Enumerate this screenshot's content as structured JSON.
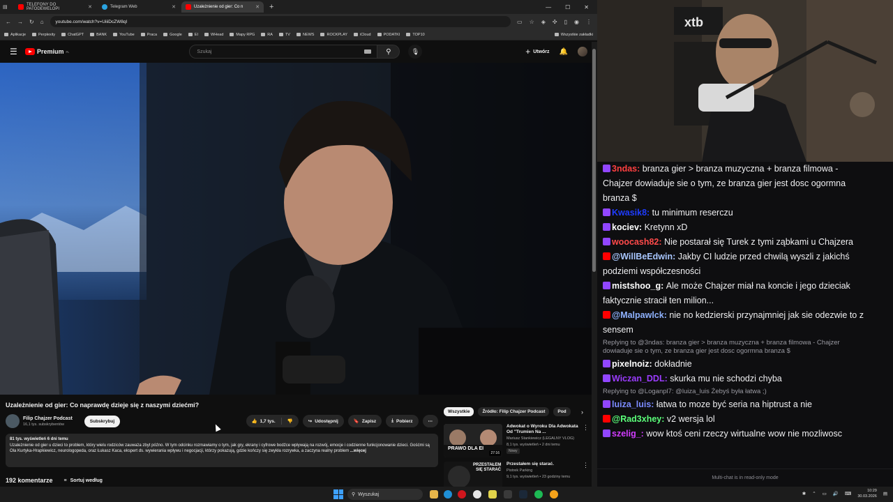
{
  "browser": {
    "tabs": [
      {
        "label": "TELEFONY DO PATODEWELOPI"
      },
      {
        "label": "Telegram Web"
      },
      {
        "label": "Uzależnienie od gier: Co n"
      }
    ],
    "url": "youtube.com/watch?v=UiiiDcZW8qI",
    "bookmarks": [
      "Aplikacje",
      "Perplexity",
      "ChatGPT",
      "BANK",
      "YouTube",
      "Praca",
      "Google",
      "EI",
      "WHead",
      "Mapy RPG",
      "RA",
      "TV",
      "NEWS",
      "ROCKPLAY",
      "iCloud",
      "PODATKI",
      "TOP10"
    ],
    "bookmarks_all": "Wszystkie zakładki"
  },
  "youtube": {
    "logo": "Premium",
    "logo_region": "PL",
    "search_placeholder": "Szukaj",
    "create_label": "Utwórz",
    "video_title": "Uzależnienie od gier: Co naprawdę dzieje się z naszymi dziećmi?",
    "channel_name": "Filip Chajzer Podcast",
    "channel_subs": "16,1 tys. subskrybentów",
    "subscribe": "Subskrybuj",
    "likes": "1,7 tys.",
    "share": "Udostępnij",
    "save": "Zapisz",
    "download": "Pobierz",
    "description_meta": "81 tys. wyświetleń  6 dni temu",
    "description_text": "Uzależnienie od gier u dzieci to problem, który wielu rodziców zauważa zbyt późno. W tym odcinku rozmawiamy o tym, jak gry, ekrany i cyfrowe bodźce wpływają na rozwój, emocje i codzienne funkcjonowanie dzieci. Gośćmi są Ola Kurtyka-Hrapkiewicz, neurologopeda, oraz Łukasz Kaca, ekspert ds. wywierania wpływu i negocjacji, którzy pokazują, gdzie kończy się zwykła rozrywka, a zaczyna realny problem",
    "description_more": "...więcej",
    "comments_count": "192 komentarze",
    "sort_label": "Sortuj według",
    "chips": [
      "Wszystkie",
      "Źródło: Filip Chajzer Podcast",
      "Pod"
    ],
    "recommendations": [
      {
        "title": "Adwokat o Wyroku Dla Adwokata Od \"Trumien Na ...",
        "channel": "Mariusz Stankiewicz (LEGALNY VLOG)",
        "meta": "8,1 tys. wyświetleń • 2 dni temu",
        "badge": "Nowy",
        "duration": "27:16",
        "thumb_text": "PRAWO DLA EI"
      },
      {
        "title": "Przestałem się starać.",
        "channel": "Piotrek Parking",
        "meta": "9,1 tys. wyświetleń • 23 godziny temu",
        "thumb_text": "PRZESTAŁEM SIĘ STARAĆ"
      }
    ]
  },
  "chat": {
    "messages": [
      {
        "user": "3ndas:",
        "color": "#ff4040",
        "text": "branza gier > branza muzyczna + branza filmowa - Chajzer dowiaduje sie o tym, ze branza gier jest dosc ogormna branza $",
        "platform": "twitch"
      },
      {
        "user": "Kwasik8:",
        "color": "#1e3cff",
        "text": "tu minimum reserczu",
        "platform": "twitch"
      },
      {
        "user": "kociev:",
        "color": "#ffffff",
        "text": "Kretynn xD",
        "platform": "twitch"
      },
      {
        "user": "woocash82:",
        "color": "#ff4a4a",
        "text": "Nie postarał się Turek z tymi ząbkami u Chajzera",
        "platform": "twitch"
      },
      {
        "user": "@WillBeEdwin:",
        "color": "#a9c7ff",
        "text": "Jakby CI ludzie przed chwilą wyszli z jakichś podziemi współczesności",
        "platform": "youtube"
      },
      {
        "user": "mistshoo_g:",
        "color": "#ffffff",
        "text": "Ale może Chajzer miał na koncie i jego dzieciak faktycznie stracił ten milion...",
        "platform": "twitch"
      },
      {
        "user": "@Malpawlck:",
        "color": "#8fb2ff",
        "text": "nie no kedzierski przynajmniej jak sie odezwie to z sensem",
        "platform": "youtube"
      },
      {
        "reply": "Replying to @3ndas: branza gier > branza muzyczna + branza filmowa - Chajzer dowiaduje sie o tym, ze branza gier jest dosc ogormna branza $"
      },
      {
        "user": "pixelnoiz:",
        "color": "#ffffff",
        "text": " dokładnie",
        "platform": "twitch"
      },
      {
        "user": "Wiczan_DDL:",
        "color": "#9b3cff",
        "text": "skurka mu nie schodzi chyba",
        "platform": "twitch"
      },
      {
        "reply": "Replying to @Loganpl7: @luiza_luis Żebyś była łatwa ;)"
      },
      {
        "user": "luiza_luis:",
        "color": "#7b8bff",
        "text": "łatwa to moze być seria na hiptrust a nie",
        "platform": "twitch"
      },
      {
        "user": "@Rad3xhey:",
        "color": "#5bff7a",
        "text": "v2 wersja lol",
        "platform": "youtube"
      },
      {
        "user": "szelig_:",
        "color": "#d13cff",
        "text": "wow ktoś ceni rzeczy wirtualne wow nie mozliwosc",
        "platform": "twitch"
      }
    ],
    "footer": "Multi-chat is in read-only mode"
  },
  "taskbar": {
    "search": "Wyszukaj",
    "time": "10:29",
    "date": "30.03.2026"
  },
  "colors": {
    "youtube_red": "#ff0000",
    "twitch_purple": "#9146ff",
    "windows_blue": "#3da0ff"
  }
}
